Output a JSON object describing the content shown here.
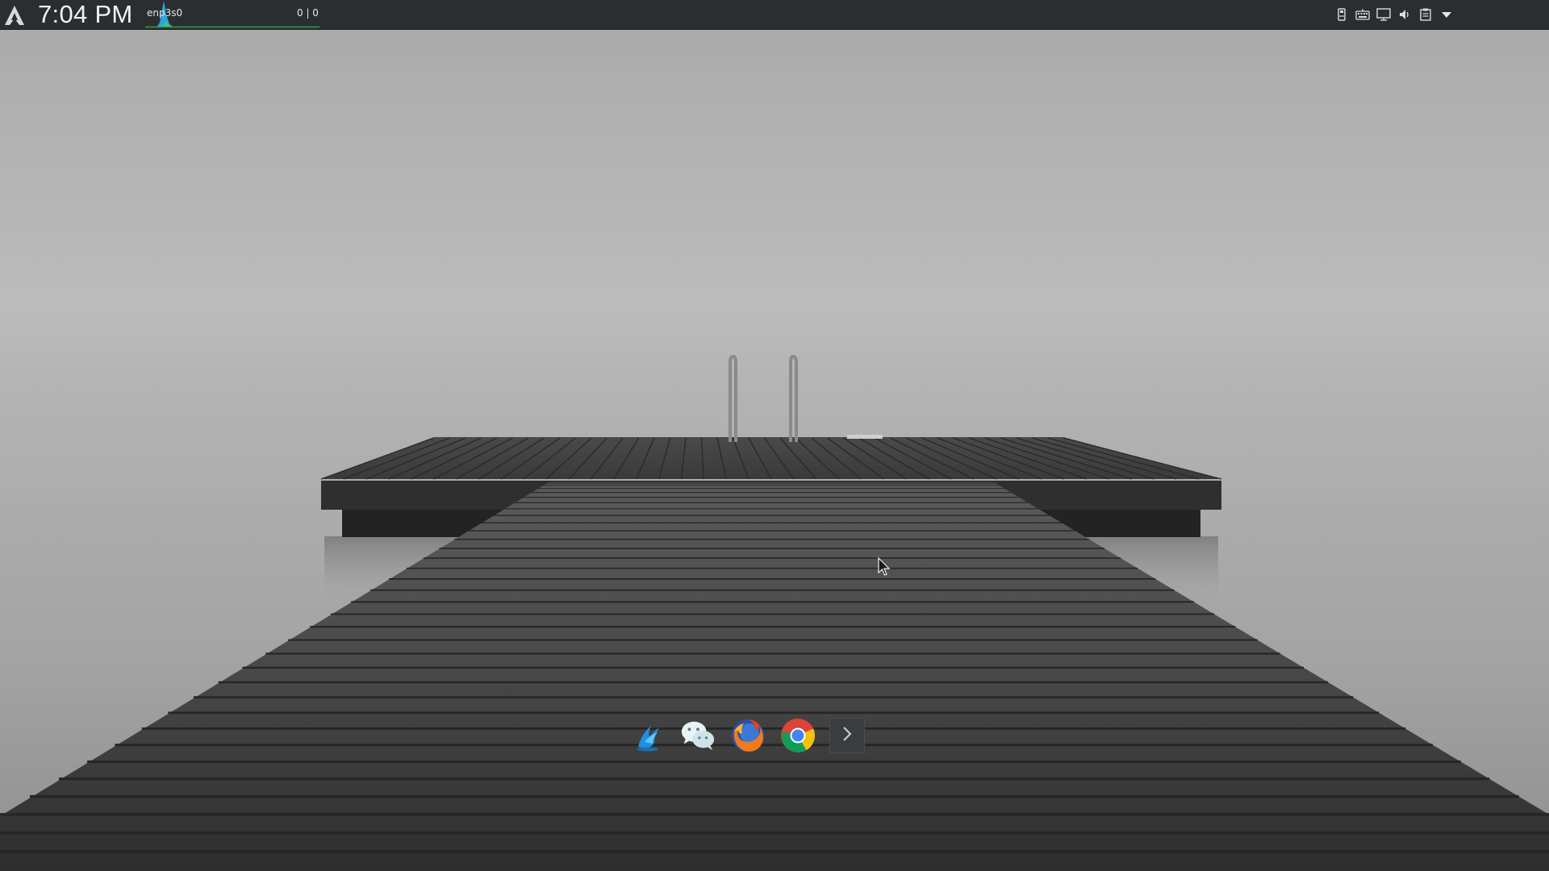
{
  "panel": {
    "clock": "7:04 PM",
    "network": {
      "interface": "enp3s0",
      "rates": "0 | 0"
    },
    "launcher_icon": "arch-logo-icon",
    "tray": [
      {
        "name": "usb-drive-icon"
      },
      {
        "name": "keyboard-icon"
      },
      {
        "name": "display-icon"
      },
      {
        "name": "volume-icon"
      },
      {
        "name": "clipboard-icon"
      },
      {
        "name": "dropdown-arrow-icon"
      }
    ],
    "colors": {
      "background": "#2b2e30",
      "graph_fill": "#2aa6e0",
      "graph_line": "#2e9e4a"
    }
  },
  "dock": {
    "items": [
      {
        "name": "deepin-app-icon"
      },
      {
        "name": "wechat-icon"
      },
      {
        "name": "firefox-icon"
      },
      {
        "name": "chrome-icon"
      },
      {
        "name": "show-more-chevron-icon"
      }
    ]
  },
  "wallpaper": {
    "subject": "foggy-lake-wooden-pier",
    "colors": {
      "sky": "#b9b9b9",
      "water": "#a3a3a3",
      "deck": "#4a4a4a"
    }
  }
}
